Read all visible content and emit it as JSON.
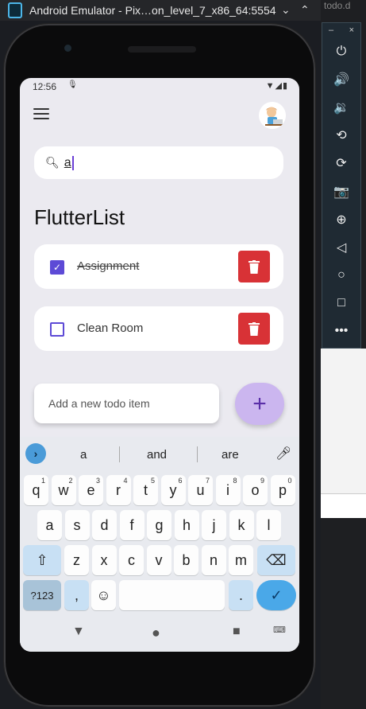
{
  "window": {
    "title": "Android Emulator - Pix…on_level_7_x86_64:5554",
    "side_tab": "todo.d"
  },
  "side_toolbar": {
    "items": [
      {
        "icon": "power-icon",
        "glyph": "⏻"
      },
      {
        "icon": "volume-up-icon",
        "glyph": "🔊"
      },
      {
        "icon": "volume-down-icon",
        "glyph": "🔉"
      },
      {
        "icon": "rotate-left-icon",
        "glyph": "⟲"
      },
      {
        "icon": "rotate-right-icon",
        "glyph": "⟳"
      },
      {
        "icon": "camera-icon",
        "glyph": "📷"
      },
      {
        "icon": "zoom-icon",
        "glyph": "⊕"
      },
      {
        "icon": "back-icon",
        "glyph": "◁"
      },
      {
        "icon": "home-icon",
        "glyph": "○"
      },
      {
        "icon": "overview-icon",
        "glyph": "□"
      },
      {
        "icon": "more-icon",
        "glyph": "•••"
      }
    ]
  },
  "status_bar": {
    "time": "12:56"
  },
  "search": {
    "value": "a"
  },
  "page_title": "FlutterList",
  "todos": [
    {
      "label": "Assignment",
      "done": true
    },
    {
      "label": "Clean Room",
      "done": false
    }
  ],
  "add_todo": {
    "placeholder": "Add a new todo item",
    "button": "+"
  },
  "keyboard": {
    "suggestions": [
      "a",
      "and",
      "are"
    ],
    "row1": [
      {
        "k": "q",
        "n": "1"
      },
      {
        "k": "w",
        "n": "2"
      },
      {
        "k": "e",
        "n": "3"
      },
      {
        "k": "r",
        "n": "4"
      },
      {
        "k": "t",
        "n": "5"
      },
      {
        "k": "y",
        "n": "6"
      },
      {
        "k": "u",
        "n": "7"
      },
      {
        "k": "i",
        "n": "8"
      },
      {
        "k": "o",
        "n": "9"
      },
      {
        "k": "p",
        "n": "0"
      }
    ],
    "row2": [
      "a",
      "s",
      "d",
      "f",
      "g",
      "h",
      "j",
      "k",
      "l"
    ],
    "row3": [
      "z",
      "x",
      "c",
      "v",
      "b",
      "n",
      "m"
    ],
    "symbols_key": "?123",
    "comma_key": ",",
    "period_key": "."
  },
  "colors": {
    "accent": "#5d4ad6",
    "delete": "#d83236",
    "fab": "#cbb6ef"
  }
}
